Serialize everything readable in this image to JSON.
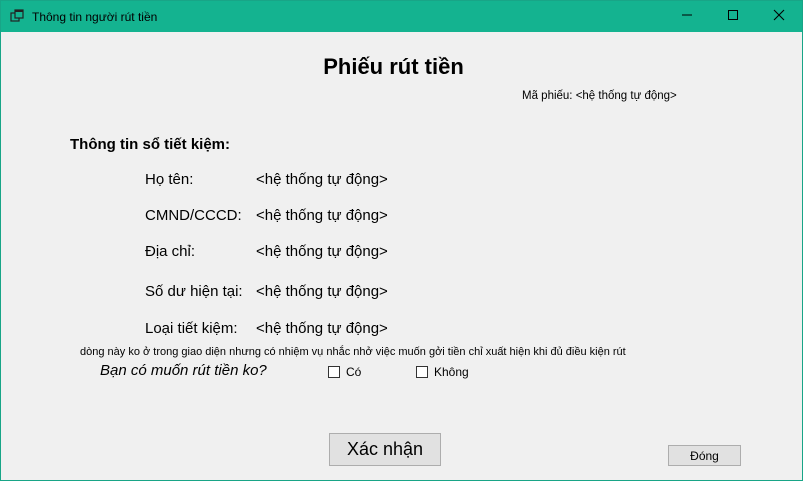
{
  "window": {
    "title": "Thông tin người rút tiền",
    "accent_color": "#14b390",
    "controls": [
      "minimize-icon",
      "maximize-icon",
      "close-icon"
    ]
  },
  "form": {
    "heading": "Phiếu rút tiền",
    "code_label": "Mã phiếu: <hệ thống tự động>",
    "section_title": "Thông tin sổ tiết kiệm:",
    "fields": [
      {
        "label": "Họ tên:",
        "value": "<hệ thống tự động>"
      },
      {
        "label": "CMND/CCCD:",
        "value": "<hệ thống tự động>"
      },
      {
        "label": "Địa chỉ:",
        "value": "<hệ thống tự động>"
      },
      {
        "label": "Số dư hiện tại:",
        "value": "<hệ thống tự động>"
      },
      {
        "label": "Loại tiết kiệm:",
        "value": "<hệ thống tự động>"
      }
    ],
    "note": "dòng này ko ở trong giao diện nhưng có nhiệm vụ nhắc nhở việc muốn gởi tiền chỉ xuất hiện khi đủ điều kiện rút",
    "question": "Bạn có muốn rút tiền ko?",
    "options": [
      {
        "label": "Có",
        "checked": false
      },
      {
        "label": "Không",
        "checked": false
      }
    ]
  },
  "buttons": {
    "confirm": "Xác nhận",
    "close": "Đóng"
  }
}
